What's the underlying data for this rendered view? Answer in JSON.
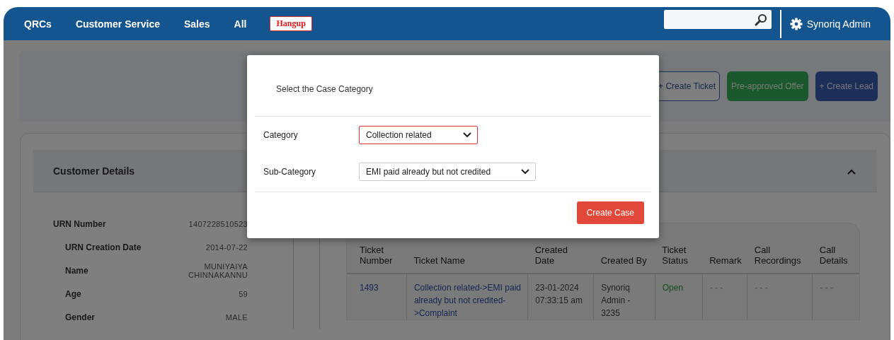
{
  "nav": {
    "items": [
      "QRCs",
      "Customer Service",
      "Sales",
      "All"
    ],
    "hangup_button": "Hangup",
    "user": "Synoriq Admin"
  },
  "toolbar": {
    "buttons": [
      {
        "label": "+ Create Ticket",
        "kind": "outline"
      },
      {
        "label": "Pre-approved Offer",
        "kind": "success"
      },
      {
        "label": "+ Create Lead",
        "kind": "primary"
      }
    ]
  },
  "customer_details": {
    "title": "Customer Details",
    "expanded": true,
    "fields": [
      {
        "label": "URN Number",
        "value": "1407228510523",
        "kind": "main"
      },
      {
        "label": "URN Creation Date",
        "value": "2014-07-22",
        "kind": "sub"
      },
      {
        "label": "Name",
        "value": "MUNIYAIYA CHINNAKANNU",
        "kind": "sub"
      },
      {
        "label": "Age",
        "value": "59",
        "kind": "sub"
      },
      {
        "label": "Gender",
        "value": "MALE",
        "kind": "sub"
      }
    ]
  },
  "tickets": {
    "columns": [
      "Ticket Number",
      "Ticket Name",
      "Created Date",
      "Created By",
      "Ticket Status",
      "Remark",
      "Call Recordings",
      "Call Details"
    ],
    "rows": [
      {
        "cells": [
          "1493",
          "Collection related->EMI paid already but not credited->Complaint",
          "23-01-2024 07:33:15 am",
          "Synoriq Admin - 3235",
          "Open",
          "- - -",
          "- - -",
          "- - -"
        ]
      }
    ]
  },
  "modal": {
    "title": "Select the Case Category",
    "fields": [
      {
        "label": "Category",
        "value": "Collection related",
        "invalid": true
      },
      {
        "label": "Sub-Category",
        "value": "EMI paid already but not credited",
        "invalid": false
      }
    ],
    "submit": "Create Case"
  }
}
